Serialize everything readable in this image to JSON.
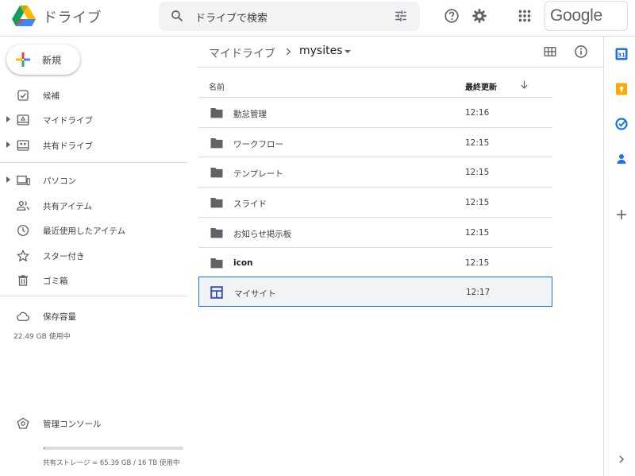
{
  "header": {
    "app_name": "ドライブ",
    "search_placeholder": "ドライブで検索",
    "google_label": "Google"
  },
  "sidebar": {
    "new_label": "新規",
    "items": [
      {
        "label": "候補",
        "icon": "check-box-icon",
        "caret": false
      },
      {
        "label": "マイドライブ",
        "icon": "my-drive-icon",
        "caret": true
      },
      {
        "label": "共有ドライブ",
        "icon": "shared-drives-icon",
        "caret": true
      },
      {
        "label": "パソコン",
        "icon": "computers-icon",
        "caret": true
      },
      {
        "label": "共有アイテム",
        "icon": "people-icon",
        "caret": false
      },
      {
        "label": "最近使用したアイテム",
        "icon": "clock-icon",
        "caret": false
      },
      {
        "label": "スター付き",
        "icon": "star-icon",
        "caret": false
      },
      {
        "label": "ゴミ箱",
        "icon": "trash-icon",
        "caret": false
      }
    ],
    "storage_label": "保存容量",
    "storage_used": "22.49 GB 使用中",
    "admin_console": "管理コンソール",
    "shared_storage": "共有ストレージ = 65.39 GB / 16 TB 使用中",
    "shared_storage_fraction": 0.004
  },
  "main": {
    "breadcrumb_root": "マイドライブ",
    "breadcrumb_current": "mysites",
    "columns": {
      "name": "名前",
      "modified": "最終更新"
    },
    "files": [
      {
        "name": "勤怠管理",
        "time": "12:16",
        "type": "folder",
        "bold": false
      },
      {
        "name": "ワークフロー",
        "time": "12:15",
        "type": "folder",
        "bold": false
      },
      {
        "name": "テンプレート",
        "time": "12:15",
        "type": "folder",
        "bold": false
      },
      {
        "name": "スライド",
        "time": "12:15",
        "type": "folder",
        "bold": false
      },
      {
        "name": "お知らせ掲示板",
        "time": "12:15",
        "type": "folder",
        "bold": false
      },
      {
        "name": "icon",
        "time": "12:15",
        "type": "folder",
        "bold": true
      },
      {
        "name": "マイサイト",
        "time": "12:17",
        "type": "site",
        "bold": false
      }
    ]
  },
  "right_panel": {
    "calendar_day": "31"
  },
  "colors": {
    "accent": "#1a73e8",
    "folder": "#5f6368",
    "site": "#3f51b5",
    "keep": "#f9ab00"
  }
}
